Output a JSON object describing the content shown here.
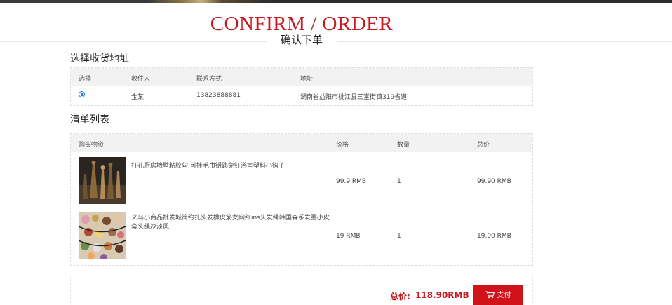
{
  "header": {
    "title_en": "CONFIRM / ORDER",
    "title_cn": "确认下单"
  },
  "address_section": {
    "title": "选择收货地址",
    "columns": [
      "选择",
      "收件人",
      "联系方式",
      "地址"
    ],
    "rows": [
      {
        "selected": true,
        "recipient": "金某",
        "phone": "13823888881",
        "address": "湖南省益阳市桃江县三堂街镇319省道"
      }
    ]
  },
  "order_section": {
    "title": "清单列表",
    "columns": [
      "购买物资",
      "价格",
      "数量",
      "总价"
    ],
    "items": [
      {
        "name": "打孔厨房墙壁粘胶勾 可挂毛巾钥匙免钉浴室塑料小钩子",
        "price": "99.9 RMB",
        "qty": "1",
        "total": "99.90 RMB",
        "thumb": "figurine-photo"
      },
      {
        "name": "义乌小商品批发城简约扎头发橡皮筋女网红ins头发绳韩国森系发圈小皮套头绳冷淡风",
        "price": "19 RMB",
        "qty": "1",
        "total": "19.00 RMB",
        "thumb": "hair-ties-photo"
      }
    ]
  },
  "summary": {
    "total_label": "总价:",
    "total_value": "118.90RMB",
    "pay_label": "支付",
    "accent_color": "#c4161c"
  }
}
